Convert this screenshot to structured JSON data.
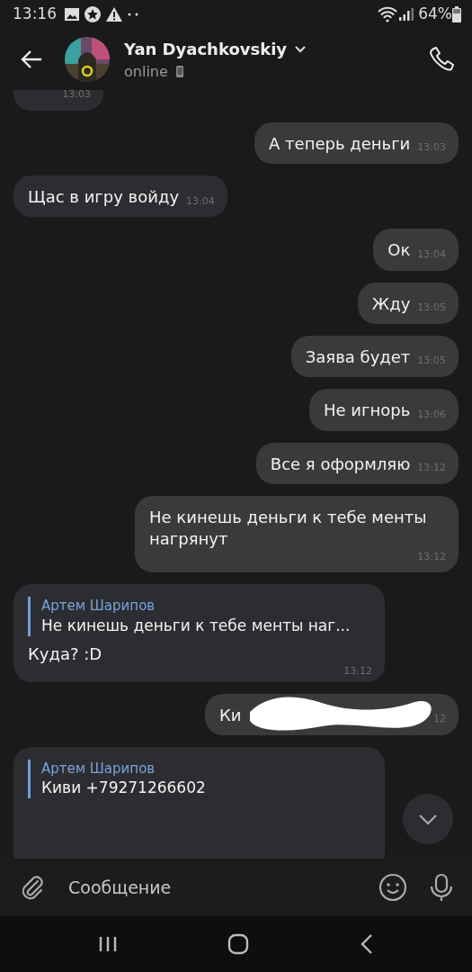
{
  "status_bar": {
    "time": "13:16",
    "battery": "64%"
  },
  "header": {
    "name": "Yan Dyachkovskiy",
    "status": "online"
  },
  "messages": [
    {
      "kind": "text",
      "outgoing": false,
      "time": "13:03"
    },
    {
      "kind": "text",
      "outgoing": true,
      "text": "А теперь деньги",
      "time": "13:03"
    },
    {
      "kind": "text",
      "outgoing": false,
      "text": "Щас в игру войду",
      "time": "13:04"
    },
    {
      "kind": "text",
      "outgoing": true,
      "text": "Ок",
      "time": "13:04"
    },
    {
      "kind": "text",
      "outgoing": true,
      "text": "Жду",
      "time": "13:05"
    },
    {
      "kind": "text",
      "outgoing": true,
      "text": "Заява будет",
      "time": "13:05"
    },
    {
      "kind": "text",
      "outgoing": true,
      "text": "Не игнорь",
      "time": "13:06"
    },
    {
      "kind": "text",
      "outgoing": true,
      "text": "Все я оформляю",
      "time": "13:12"
    },
    {
      "kind": "text",
      "outgoing": true,
      "text": "Не кинешь деньги к тебе менты нагрянут",
      "time": "13:12"
    },
    {
      "kind": "reply",
      "outgoing": false,
      "quote_author": "Артем Шарипов",
      "quote_text": "Не кинешь деньги к тебе менты наг...",
      "text": "Куда? :D",
      "time": "13:12"
    },
    {
      "kind": "redacted",
      "outgoing": true,
      "text": "Ки",
      "time": "12"
    },
    {
      "kind": "reply",
      "outgoing": false,
      "quote_author": "Артем Шарипов",
      "quote_text": "Киви +79271266602"
    }
  ],
  "composer": {
    "placeholder": "Сообщение"
  }
}
